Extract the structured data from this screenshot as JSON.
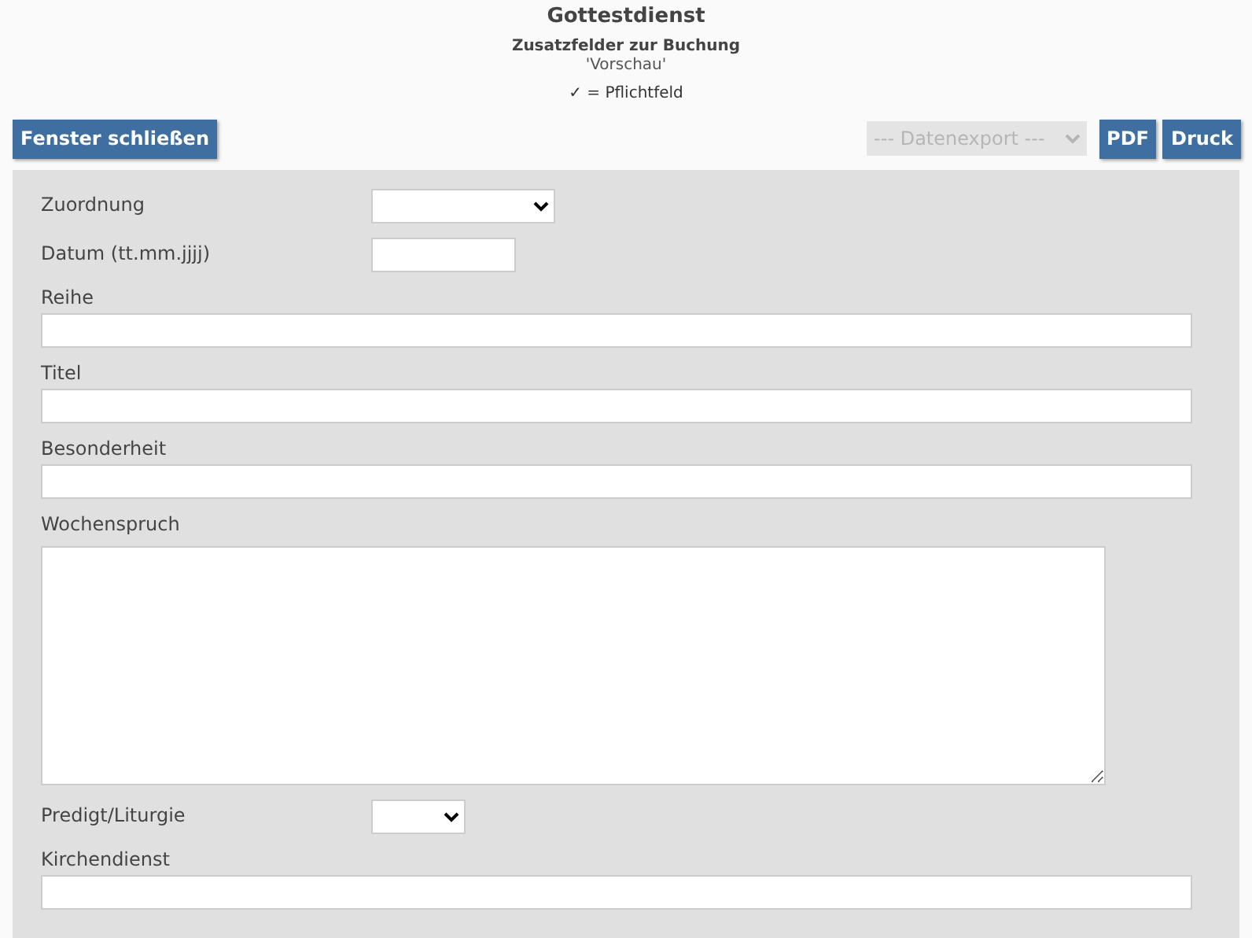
{
  "header": {
    "title": "Gottestdienst",
    "subtitle": "Zusatzfelder zur Buchung",
    "mode": "'Vorschau'",
    "legend": "✓ = Pflichtfeld"
  },
  "toolbar": {
    "close_button": "Fenster schließen",
    "export_select": {
      "value": "--- Datenexport ---",
      "disabled": true
    },
    "buttons": [
      "PDF",
      "Druck"
    ]
  },
  "fields": [
    {
      "label": "Zuordnung",
      "kind": "select"
    },
    {
      "label": "Datum (tt.mm.jjjj)",
      "kind": "date"
    },
    {
      "label": "Reihe",
      "kind": "text"
    },
    {
      "label": "Titel",
      "kind": "text"
    },
    {
      "label": "Besonderheit",
      "kind": "text"
    },
    {
      "label": "Wochenspruch",
      "kind": "textarea"
    },
    {
      "label": "Predigt/Liturgie",
      "kind": "select"
    },
    {
      "label": "Kirchendienst",
      "kind": "text"
    }
  ]
}
